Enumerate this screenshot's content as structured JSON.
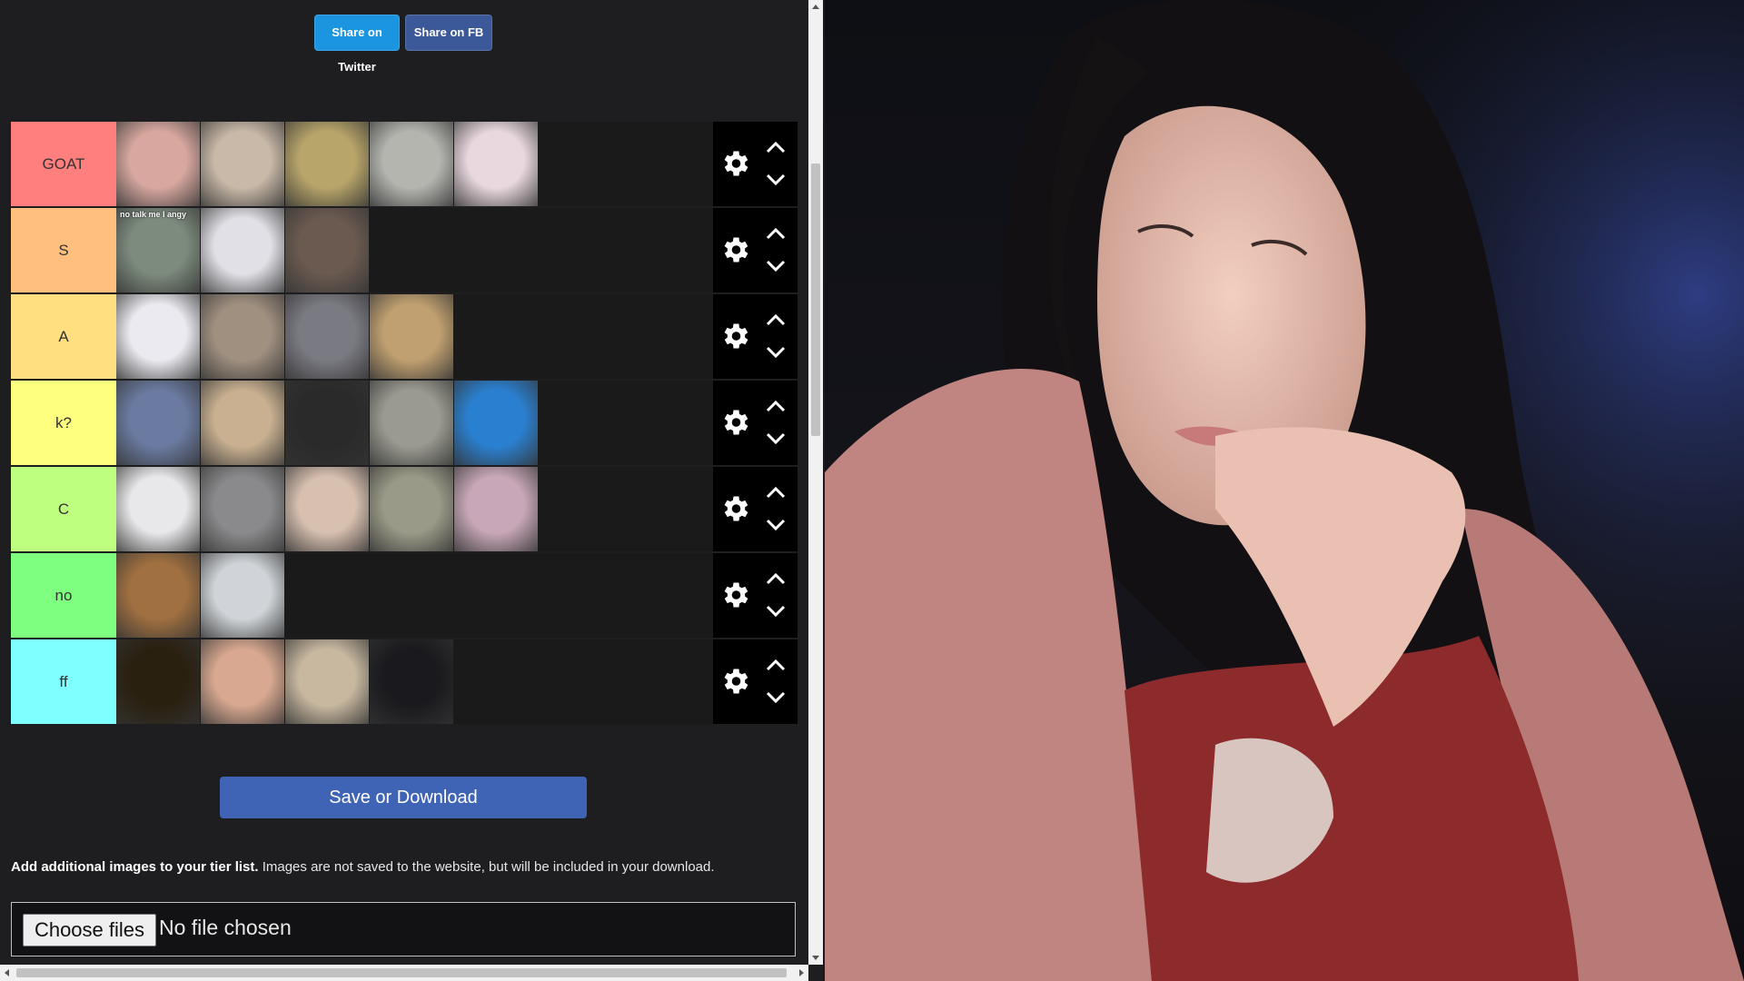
{
  "share": {
    "twitter_label": "Share on Twitter",
    "facebook_label": "Share on FB"
  },
  "colors": {
    "twitter": "#1b95e0",
    "facebook": "#3b5998",
    "save": "#3f63b5"
  },
  "tiers": [
    {
      "label": "GOAT",
      "color": "#ff7f7f",
      "item_count": 5
    },
    {
      "label": "S",
      "color": "#ffbf7f",
      "item_count": 3
    },
    {
      "label": "A",
      "color": "#ffdf80",
      "item_count": 4
    },
    {
      "label": "k?",
      "color": "#ffff7f",
      "item_count": 5
    },
    {
      "label": "C",
      "color": "#bfff7f",
      "item_count": 5
    },
    {
      "label": "no",
      "color": "#7fff7f",
      "item_count": 2
    },
    {
      "label": "ff",
      "color": "#7fffff",
      "item_count": 4
    }
  ],
  "tile_caption": "no talk me I angy",
  "save_button": "Save or Download",
  "help": {
    "bold": "Add additional images to your tier list.",
    "rest": " Images are not saved to the website, but will be included in your download."
  },
  "file_input": {
    "button": "Choose files",
    "status": "No file chosen"
  },
  "icons": {
    "tier_settings": "gear-icon",
    "move_up": "chevron-up-icon",
    "move_down": "chevron-down-icon"
  }
}
